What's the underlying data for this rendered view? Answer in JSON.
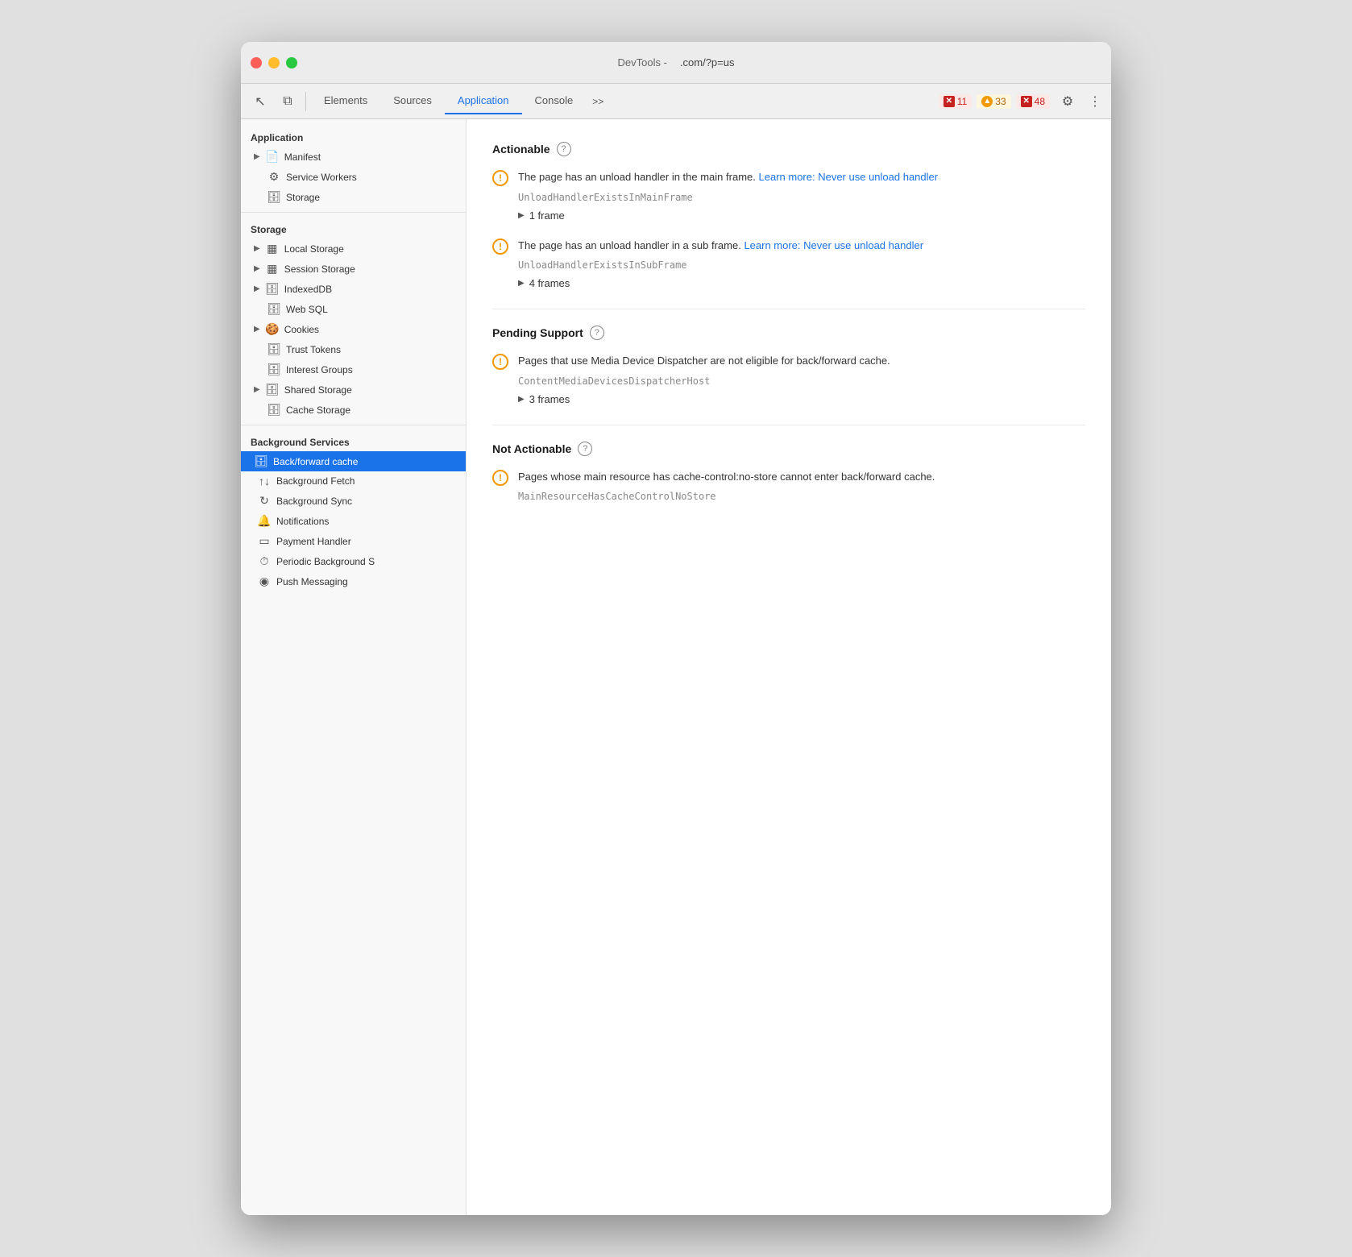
{
  "window": {
    "title": "DevTools -",
    "url": ".com/?p=us"
  },
  "toolbar": {
    "tabs": [
      {
        "id": "elements",
        "label": "Elements",
        "active": false
      },
      {
        "id": "sources",
        "label": "Sources",
        "active": false
      },
      {
        "id": "application",
        "label": "Application",
        "active": true
      },
      {
        "id": "console",
        "label": "Console",
        "active": false
      }
    ],
    "more_label": ">>",
    "errors_count": "11",
    "warnings_count": "33",
    "issues_count": "48",
    "settings_icon": "⚙",
    "more_icon": "⋮"
  },
  "sidebar": {
    "app_section_title": "Application",
    "storage_section_title": "Storage",
    "bg_services_section_title": "Background Services",
    "app_items": [
      {
        "id": "manifest",
        "label": "Manifest",
        "icon": "▶",
        "has_expand": true,
        "indent": 0
      },
      {
        "id": "service-workers",
        "label": "Service Workers",
        "icon": "⚙",
        "has_expand": false,
        "indent": 0
      },
      {
        "id": "storage",
        "label": "Storage",
        "icon": "🗄",
        "has_expand": false,
        "indent": 0
      }
    ],
    "storage_items": [
      {
        "id": "local-storage",
        "label": "Local Storage",
        "icon": "▶",
        "has_expand": true,
        "indent": 0
      },
      {
        "id": "session-storage",
        "label": "Session Storage",
        "icon": "▶",
        "has_expand": true,
        "indent": 0
      },
      {
        "id": "indexeddb",
        "label": "IndexedDB",
        "icon": "▶",
        "has_expand": true,
        "indent": 0
      },
      {
        "id": "web-sql",
        "label": "Web SQL",
        "icon": "",
        "has_expand": false,
        "indent": 0
      },
      {
        "id": "cookies",
        "label": "Cookies",
        "icon": "▶",
        "has_expand": true,
        "indent": 0
      },
      {
        "id": "trust-tokens",
        "label": "Trust Tokens",
        "icon": "",
        "has_expand": false,
        "indent": 0
      },
      {
        "id": "interest-groups",
        "label": "Interest Groups",
        "icon": "",
        "has_expand": false,
        "indent": 0
      },
      {
        "id": "shared-storage",
        "label": "Shared Storage",
        "icon": "▶",
        "has_expand": true,
        "indent": 0
      },
      {
        "id": "cache-storage",
        "label": "Cache Storage",
        "icon": "",
        "has_expand": false,
        "indent": 0
      }
    ],
    "bg_service_items": [
      {
        "id": "back-forward-cache",
        "label": "Back/forward cache",
        "icon": "🗄",
        "active": true
      },
      {
        "id": "background-fetch",
        "label": "Background Fetch",
        "icon": "↑↓"
      },
      {
        "id": "background-sync",
        "label": "Background Sync",
        "icon": "↻"
      },
      {
        "id": "notifications",
        "label": "Notifications",
        "icon": "🔔"
      },
      {
        "id": "payment-handler",
        "label": "Payment Handler",
        "icon": "🪪"
      },
      {
        "id": "periodic-background",
        "label": "Periodic Background S",
        "icon": "🕐"
      },
      {
        "id": "push-messaging",
        "label": "Push Messaging",
        "icon": "📢"
      }
    ]
  },
  "panel": {
    "actionable_section": {
      "title": "Actionable",
      "issues": [
        {
          "id": "unload-main-frame",
          "text_before_link": "The page has an unload handler in the main frame.",
          "link_text": "Learn more: Never use unload handler",
          "code": "UnloadHandlerExistsInMainFrame",
          "frames_label": "1 frame"
        },
        {
          "id": "unload-sub-frame",
          "text_before_link": "The page has an unload handler in a sub frame.",
          "link_text": "Learn more: Never use unload handler",
          "code": "UnloadHandlerExistsInSubFrame",
          "frames_label": "4 frames"
        }
      ]
    },
    "pending_support_section": {
      "title": "Pending Support",
      "issues": [
        {
          "id": "media-device-dispatcher",
          "text": "Pages that use Media Device Dispatcher are not eligible for back/forward cache.",
          "code": "ContentMediaDevicesDispatcherHost",
          "frames_label": "3 frames"
        }
      ]
    },
    "not_actionable_section": {
      "title": "Not Actionable",
      "issues": [
        {
          "id": "cache-control-no-store",
          "text": "Pages whose main resource has cache-control:no-store cannot enter back/forward cache.",
          "code": "MainResourceHasCacheControlNoStore"
        }
      ]
    }
  },
  "icons": {
    "cursor": "↖",
    "layers": "⧉",
    "warning_circle": "!",
    "expand_arrow": "▶",
    "settings": "⚙",
    "more_vert": "⋮",
    "database": "🗄",
    "sync": "↻",
    "bell": "🔔",
    "payment": "▭",
    "clock": "⏱",
    "push": "◉"
  },
  "colors": {
    "accent_blue": "#1a73e8",
    "error_red": "#c5221f",
    "warning_orange": "#f29900",
    "active_sidebar": "#1a73e8"
  }
}
